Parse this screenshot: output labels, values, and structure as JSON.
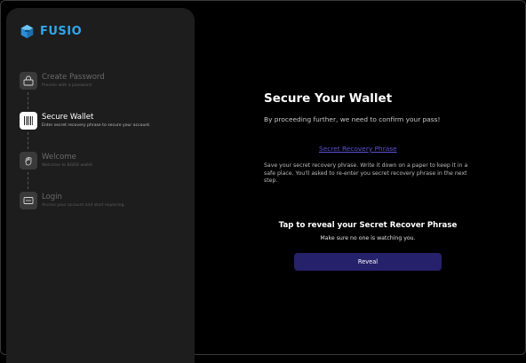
{
  "brand": {
    "name": "FUSIO",
    "accent": "#2fa7ee"
  },
  "steps": [
    {
      "title": "Create Password",
      "subtitle": "Provide with a password.",
      "icon": "password-lock-icon",
      "active": false
    },
    {
      "title": "Secure Wallet",
      "subtitle": "Enter secret recovery phrase to secure your account.",
      "icon": "barcode-icon",
      "active": true
    },
    {
      "title": "Welcome",
      "subtitle": "Welcome to BGRD wallet",
      "icon": "wave-hand-icon",
      "active": false
    },
    {
      "title": "Login",
      "subtitle": "Access your account and start exploring.",
      "icon": "login-card-icon",
      "active": false
    }
  ],
  "main": {
    "title": "Secure Your Wallet",
    "lead": "By proceeding further, we need to confirm your pass!",
    "phrase_link": "Secret Recovery Phrase",
    "note": "Save your secret recovery phrase. Write it down on a paper to keep it in a safe place. You'll asked to re-enter you secret recovery phrase in the next step.",
    "reveal_title": "Tap to reveal your Secret Recover Phrase",
    "reveal_subtitle": "Make sure no one is watching you.",
    "reveal_button": "Reveal"
  },
  "colors": {
    "background": "#000000",
    "sidebar": "#1d1d1d",
    "link": "#5b52d6",
    "button": "#26216b"
  }
}
